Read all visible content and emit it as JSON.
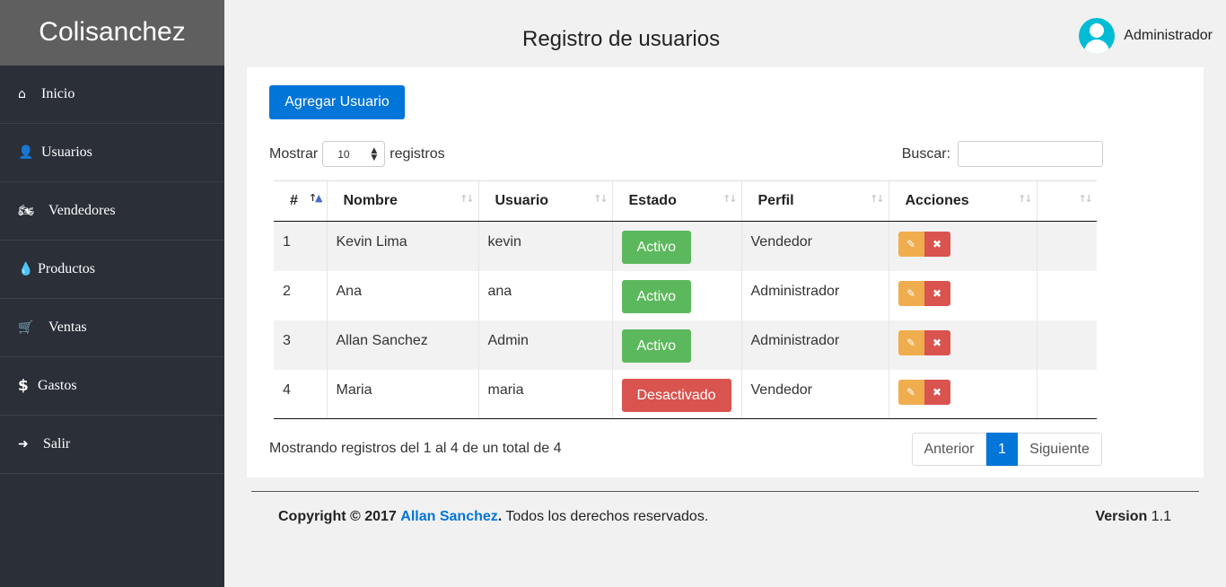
{
  "brand": "Colisanchez",
  "sidebar": {
    "items": [
      {
        "label": "Inicio",
        "icon": "home-icon",
        "glyph": "⌂"
      },
      {
        "label": "Usuarios",
        "icon": "user-icon",
        "glyph": "👤"
      },
      {
        "label": "Vendedores",
        "icon": "motorcycle-icon",
        "glyph": "🏍"
      },
      {
        "label": "Productos",
        "icon": "tint-icon",
        "glyph": "💧"
      },
      {
        "label": "Ventas",
        "icon": "cart-icon",
        "glyph": "🛒"
      },
      {
        "label": "Gastos",
        "icon": "dollar-icon",
        "glyph": "$"
      },
      {
        "label": "Salir",
        "icon": "sign-out-icon",
        "glyph": "➜"
      }
    ]
  },
  "header": {
    "title": "Registro de usuarios",
    "user": "Administrador"
  },
  "toolbar": {
    "add_label": "Agregar Usuario"
  },
  "length": {
    "prefix": "Mostrar",
    "value": "10",
    "suffix": "registros"
  },
  "search": {
    "label": "Buscar:",
    "value": ""
  },
  "table": {
    "columns": [
      "#",
      "Nombre",
      "Usuario",
      "Estado",
      "Perfil",
      "Acciones",
      ""
    ],
    "rows": [
      {
        "id": "1",
        "nombre": "Kevin Lima",
        "usuario": "kevin",
        "estado": "Activo",
        "perfil": "Vendedor"
      },
      {
        "id": "2",
        "nombre": "Ana",
        "usuario": "ana",
        "estado": "Activo",
        "perfil": "Administrador"
      },
      {
        "id": "3",
        "nombre": "Allan Sanchez",
        "usuario": "Admin",
        "estado": "Activo",
        "perfil": "Administrador"
      },
      {
        "id": "4",
        "nombre": "Maria",
        "usuario": "maria",
        "estado": "Desactivado",
        "perfil": "Vendedor"
      }
    ]
  },
  "info": "Mostrando registros del 1 al 4 de un total de 4",
  "pagination": {
    "prev": "Anterior",
    "current": "1",
    "next": "Siguiente"
  },
  "footer": {
    "copyright_prefix": "Copyright © 2017",
    "author": "Allan Sanchez",
    "rights": ". Todos los derechos reservados.",
    "version_label": "Version",
    "version_value": "1.1"
  },
  "colors": {
    "primary": "#0275d8",
    "success": "#5cb85c",
    "danger": "#d9534f",
    "warning": "#f0ad4e",
    "sidebar": "#2a2f38"
  }
}
